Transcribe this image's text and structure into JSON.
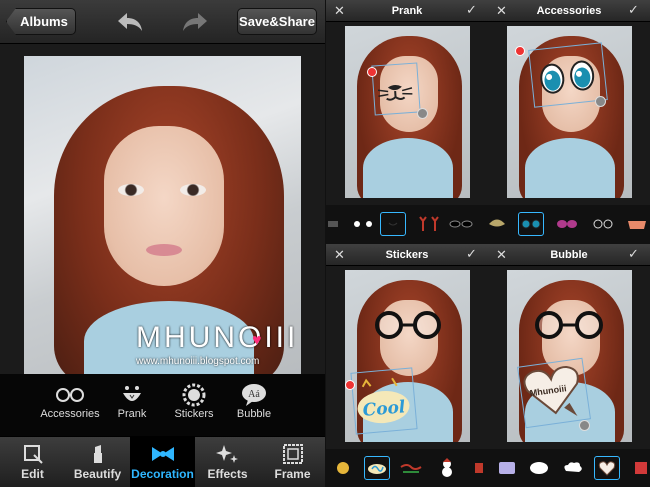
{
  "toolbar": {
    "albums_label": "Albums",
    "save_label": "Save&Share"
  },
  "watermark": {
    "main": "MHUNOIII",
    "url": "www.mhunoiii.blogspot.com"
  },
  "decoration_tools": [
    {
      "label": "Accessories",
      "icon": "glasses-icon"
    },
    {
      "label": "Prank",
      "icon": "prank-face-icon"
    },
    {
      "label": "Stickers",
      "icon": "sticker-icon"
    },
    {
      "label": "Bubble",
      "icon": "speech-bubble-icon"
    }
  ],
  "tabs": [
    {
      "label": "Edit",
      "icon": "crop-icon"
    },
    {
      "label": "Beautify",
      "icon": "lipstick-icon"
    },
    {
      "label": "Decoration",
      "icon": "bow-icon",
      "active": true
    },
    {
      "label": "Effects",
      "icon": "sparkle-icon"
    },
    {
      "label": "Frame",
      "icon": "frame-icon"
    }
  ],
  "panels": {
    "prank": {
      "title": "Prank"
    },
    "accessories": {
      "title": "Accessories"
    },
    "stickers": {
      "title": "Stickers",
      "sticker_text": "Cool"
    },
    "bubble": {
      "title": "Bubble",
      "bubble_text": "Mhunoiii"
    }
  },
  "colors": {
    "active_tab": "#2fb6ff",
    "selection": "#37b8ff",
    "delete": "#e33333"
  }
}
